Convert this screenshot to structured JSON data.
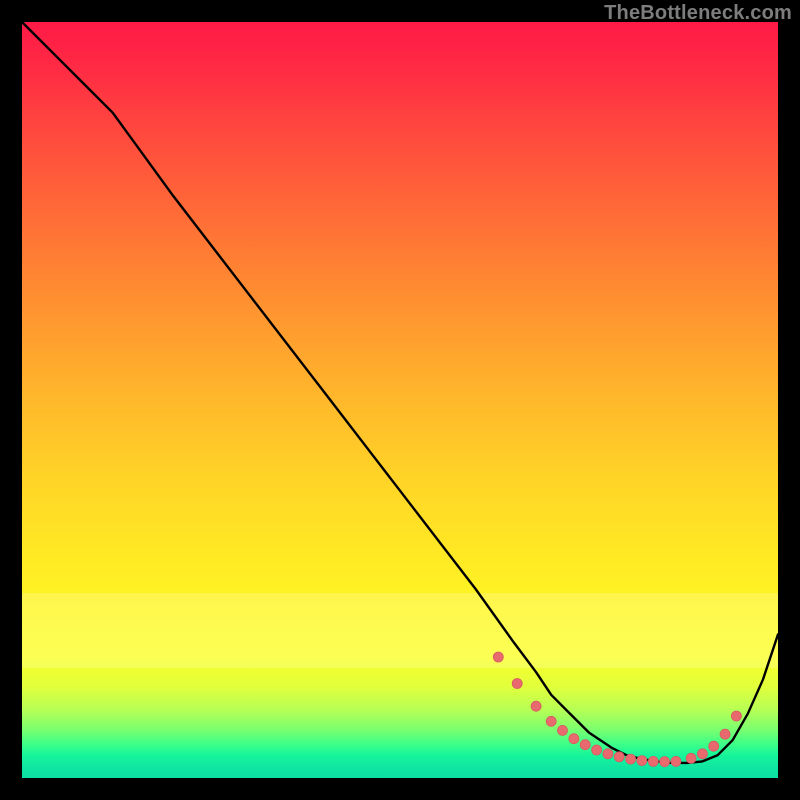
{
  "watermark": "TheBottleneck.com",
  "colors": {
    "dot": "#e86a6f",
    "dot_stroke": "#d85a60",
    "line": "#000000",
    "frame_bg": "#000000"
  },
  "chart_data": {
    "type": "line",
    "title": "",
    "xlabel": "",
    "ylabel": "",
    "xlim": [
      0,
      100
    ],
    "ylim": [
      0,
      100
    ],
    "note": "No axis ticks, labels, or numeric scales are rendered; values below are normalized 0–100 in plot coordinates (y: 0 at bottom, 100 at top).",
    "series": [
      {
        "name": "curve",
        "x": [
          0,
          5,
          8,
          12,
          20,
          30,
          40,
          50,
          60,
          65,
          68,
          70,
          72,
          75,
          78,
          80,
          82,
          84,
          86,
          88,
          90,
          92,
          94,
          96,
          98,
          100
        ],
        "y": [
          100,
          95,
          92,
          88,
          77,
          64,
          51,
          38,
          25,
          18,
          14,
          11,
          9,
          6,
          4,
          3,
          2.5,
          2.2,
          2.0,
          2.0,
          2.2,
          3.0,
          5.0,
          8.5,
          13,
          19
        ]
      }
    ],
    "markers": {
      "name": "bottom-plateau-dots",
      "x": [
        63,
        65.5,
        68,
        70,
        71.5,
        73,
        74.5,
        76,
        77.5,
        79,
        80.5,
        82,
        83.5,
        85,
        86.5,
        88.5,
        90,
        91.5,
        93,
        94.5
      ],
      "y": [
        16,
        12.5,
        9.5,
        7.5,
        6.3,
        5.2,
        4.4,
        3.7,
        3.2,
        2.8,
        2.5,
        2.3,
        2.2,
        2.15,
        2.2,
        2.6,
        3.2,
        4.2,
        5.8,
        8.2
      ]
    }
  }
}
